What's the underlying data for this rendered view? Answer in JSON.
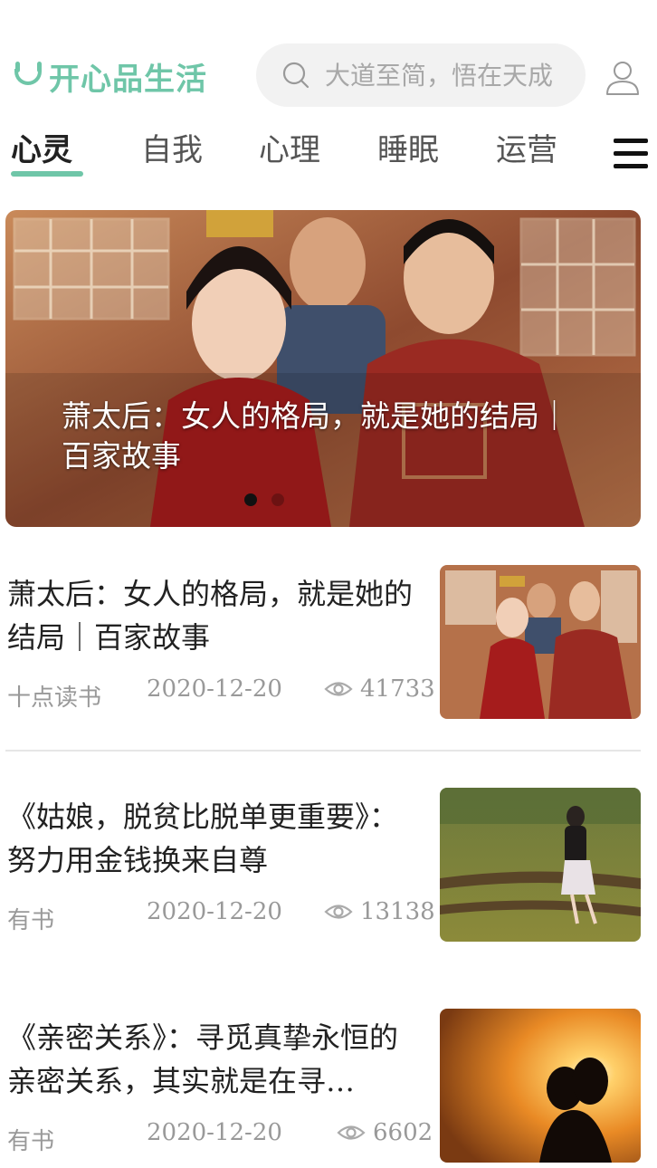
{
  "header": {
    "logo_text": "开心品生活",
    "search_placeholder": "大道至简，悟在天成",
    "icons": {
      "search": "search-icon",
      "user": "user-icon",
      "menu": "menu-icon"
    },
    "accent_color": "#6fc6a8"
  },
  "tabs": [
    {
      "label": "心灵",
      "active": true
    },
    {
      "label": "自我",
      "active": false
    },
    {
      "label": "心理",
      "active": false
    },
    {
      "label": "睡眠",
      "active": false
    },
    {
      "label": "运营",
      "active": false
    }
  ],
  "banner": {
    "title": "萧太后：女人的格局，就是她的结局｜百家故事",
    "slide_count": 2,
    "active_slide": 1
  },
  "articles": [
    {
      "title": "萧太后：女人的格局，就是她的结局｜百家故事",
      "source": "十点读书",
      "date": "2020-12-20",
      "views": "41733"
    },
    {
      "title": "《姑娘，脱贫比脱单更重要》：努力用金钱换来自尊",
      "source": "有书",
      "date": "2020-12-20",
      "views": "13138"
    },
    {
      "title": "《亲密关系》：寻觅真挚永恒的亲密关系，其实就是在寻…",
      "source": "有书",
      "date": "2020-12-20",
      "views": "6602"
    }
  ]
}
